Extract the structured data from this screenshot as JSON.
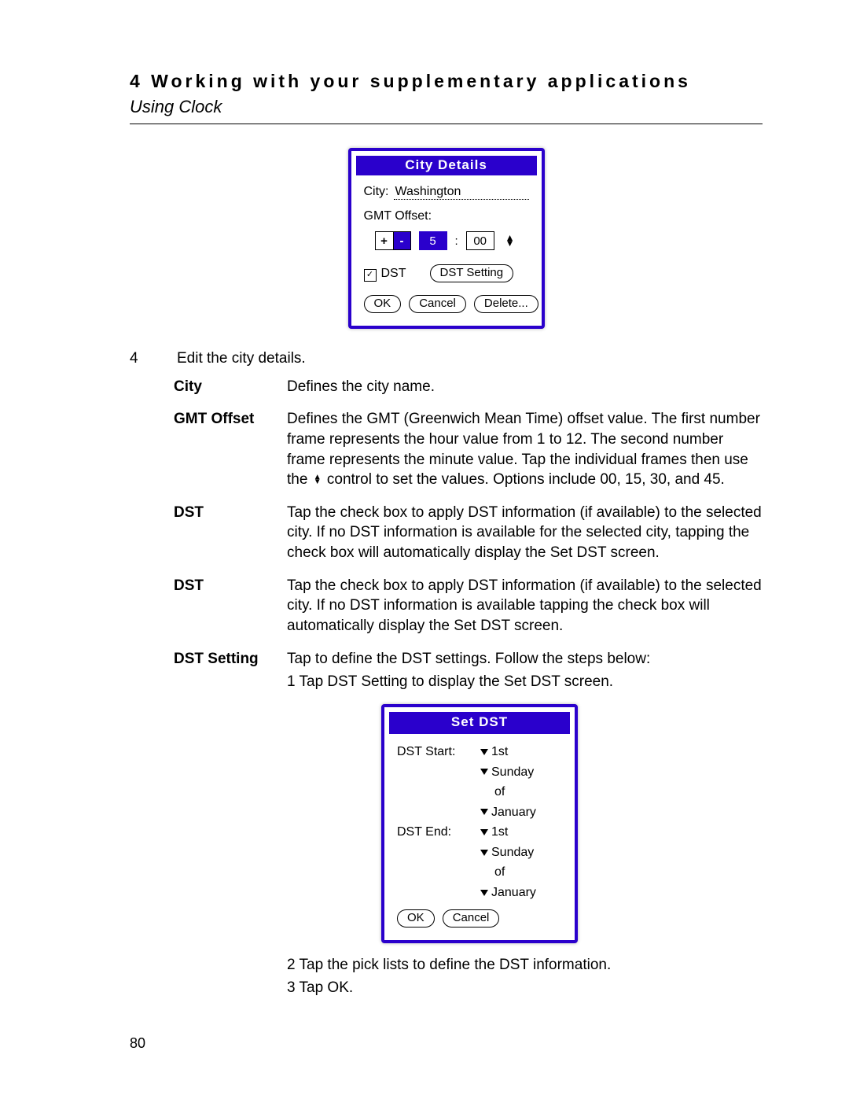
{
  "header": {
    "chapter": "4 Working with your supplementary applications",
    "subtitle": "Using Clock"
  },
  "cityDetails": {
    "title": "City Details",
    "cityLabel": "City:",
    "cityValue": "Washington",
    "gmtLabel": "GMT Offset:",
    "plus": "+",
    "minus": "-",
    "hours": "5",
    "minutes": "00",
    "dstCheck": "✓",
    "dstLabel": "DST",
    "dstSettingBtn": "DST Setting",
    "ok": "OK",
    "cancel": "Cancel",
    "delete": "Delete..."
  },
  "step": {
    "num": "4",
    "text": "Edit the city details."
  },
  "defs": {
    "cityTerm": "City",
    "cityBody": "Defines the city name.",
    "gmtTerm": "GMT Offset",
    "gmtBody1": "Defines the GMT (Greenwich Mean Time) offset value. The first number frame represents the hour value from 1 to 12. The second number frame represents the minute value. Tap the individual frames then use the ",
    "gmtBody2": " control to set the values. Options include 00, 15, 30, and 45.",
    "dst1Term": "DST",
    "dst1Body": "Tap the check box to apply DST information (if available) to the selected city. If no DST information is available for the selected city, tapping the check box will automatically display the Set DST screen.",
    "dst2Term": "DST",
    "dst2Body": "Tap the check box to apply DST information (if available) to the selected city. If no DST information is available tapping the check box will automatically display the Set DST screen.",
    "dstSettingTerm": "DST Setting",
    "dstSettingBody": "Tap to define the DST settings. Follow the steps below:",
    "sub1": "1 Tap DST Setting to display the Set DST screen.",
    "sub2": "2 Tap the pick lists to define the DST information.",
    "sub3": "3 Tap OK."
  },
  "setDst": {
    "title": "Set DST",
    "startLabel": "DST Start:",
    "endLabel": "DST End:",
    "occ": "1st",
    "day": "Sunday",
    "of": "of",
    "month": "January",
    "ok": "OK",
    "cancel": "Cancel"
  },
  "pageNumber": "80"
}
